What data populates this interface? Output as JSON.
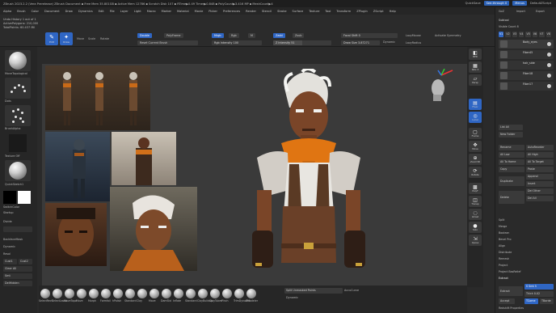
{
  "app": {
    "title": "ZBrush 2023.2.2 (Vera Prerelease)   ZBrush Document   ▪ Free Mem 35.801GB ▪ Active Mem 12786 ▪ Scratch Disk 107 ▪ RTime▶0.49 Timer▶0.848 ▪ PolyCount▶3.416 MP ▪ MeshCount▶4",
    "quicksave": "QuickSave",
    "see_through": "See-through  0",
    "menus_label": "Menus",
    "script": "DefaultZScript"
  },
  "menu": [
    "Alpha",
    "Brush",
    "Color",
    "Document",
    "Draw",
    "Dynamics",
    "Edit",
    "File",
    "Layer",
    "Light",
    "Macro",
    "Marker",
    "Material",
    "Movie",
    "Picker",
    "Preferences",
    "Render",
    "Stencil",
    "Stroke",
    "Surface",
    "Texture",
    "Tool",
    "Transform",
    "ZPlugin",
    "ZScript",
    "Help"
  ],
  "topbar": {
    "undo_history": "Undo History 1 out of 1",
    "active_polygons": "ActivePolygons: 210,000",
    "total_points": "TotalPoints: 60.437 Mil",
    "tools": [
      {
        "name": "edit-tool",
        "label": "Edit"
      },
      {
        "name": "draw-tool",
        "label": "Draw"
      },
      {
        "name": "move-tool",
        "label": "Move"
      },
      {
        "name": "scale-tool",
        "label": "Scale"
      },
      {
        "name": "rotate-tool",
        "label": "Rotate"
      }
    ],
    "sculptris": "Sculptris Pro",
    "double": "Double",
    "polyframe": "PolyFrame",
    "reset_brush": "Reset Current Brush",
    "mrgb": "Mrgb",
    "rgb": "Rgb",
    "m": "M",
    "zadd": "Zadd",
    "zsub": "Zsub",
    "rgb_intensity": "Rgb Intensity 100",
    "z_intensity": "Z Intensity 51",
    "focal_shift": "Focal Shift 0",
    "draw_size": "Draw Size 3.87271",
    "dynamic": "Dynamic",
    "lazymouse": "LazyMouse",
    "lazyradius": "LazyRadius",
    "activate_symmetry": "Activate Symmetry"
  },
  "leftshelf": {
    "brush": "MoveTopological",
    "stroke": "Dots",
    "alpha": "BrushAlpha",
    "texture": "Texture Off",
    "material": "QuickSketch1",
    "switch_color": "SwitchColor",
    "startup": "Startup",
    "divide": "Divide",
    "backface_mask": "BackfaceMask",
    "dynamesh": "Dynamic",
    "resolution": "Resol",
    "cust1": "Cust1",
    "cust2": "Cust2",
    "clear_all": "Clear All",
    "smt": "Smt",
    "delhidden": "DelHidden"
  },
  "rightstrip": [
    {
      "name": "bpr-button",
      "label": "BPR"
    },
    {
      "name": "spix-button",
      "label": "SPix 3"
    },
    {
      "name": "dynamic-persp-button",
      "label": "Persp"
    },
    {
      "name": "floor-button",
      "label": "Floor"
    },
    {
      "name": "local-button",
      "label": "Local"
    },
    {
      "name": "frame-button",
      "label": "Frame"
    },
    {
      "name": "move-view-button",
      "label": "Move"
    },
    {
      "name": "zoom3d-button",
      "label": "Zoom3D"
    },
    {
      "name": "rotate-view-button",
      "label": "Rotate"
    },
    {
      "name": "polyf-button",
      "label": "PolyF"
    },
    {
      "name": "transp-button",
      "label": "Transp"
    },
    {
      "name": "ghost-button",
      "label": "Ghost"
    },
    {
      "name": "solo-button",
      "label": "Solo"
    },
    {
      "name": "xpose-button",
      "label": "Xpose"
    }
  ],
  "rightpanel": {
    "header": "GoZ",
    "import": "Import",
    "export": "Export",
    "subtool_title": "Subtool",
    "visible_count": "Visible Count 8",
    "tabs": [
      "V1",
      "V2",
      "V3",
      "V4",
      "V5",
      "V6",
      "V7",
      "V8"
    ],
    "subtools": [
      "Body_eyes",
      "Fiber45",
      "hair_side",
      "Fiber18",
      "Fiber17"
    ],
    "list_all": "List All",
    "new_folder": "New Folder",
    "rename": "Rename",
    "autoreorder": "AutoReorder",
    "all_low": "All Low",
    "all_high": "All High",
    "all_to_home": "All To Home",
    "all_to_target": "All To Target",
    "copy": "Copy",
    "paste": "Paste",
    "duplicate": "Duplicate",
    "append": "Append",
    "insert": "Insert",
    "delete": "Delete",
    "del_other": "Del Other",
    "del_all": "Del All",
    "split": "Split",
    "merge": "Merge",
    "boolean": "Boolean",
    "bevel_pro": "Bevel Pro",
    "align": "Align",
    "distribute": "Distribute",
    "remesh": "Remesh",
    "project": "Project",
    "project_bas": "Project BasRelief",
    "extract": "Extract",
    "extract_btn": "Extract",
    "s_smt": "S Smt 5",
    "thick": "Thick 0.02",
    "accept": "Accept",
    "tcorne": "TCorne",
    "tborde": "TBorde",
    "redshift": "Redshift Properties"
  },
  "bottombar": {
    "brushes": [
      "SelectRect",
      "SelectLasso",
      "MoveTopo",
      "Move",
      "Morph",
      "Formfoil",
      "hPolish",
      "Standard",
      "Clay",
      "Move",
      "DamStd",
      "Inflate",
      "Standard",
      "ClayBuildup",
      "ClayTubes",
      "Pinch",
      "TrimDynamic",
      "ZModeler"
    ],
    "split_unmasked": "Split Unmasked Points",
    "accucurve": "AccuCurve",
    "dynamic": "Dynamic"
  },
  "colors": {
    "accent": "#2f66c4",
    "bg": "#2a2a2a",
    "viewport": "#3a3a3a",
    "scarf": "#e07512",
    "skin": "#7a4528"
  }
}
